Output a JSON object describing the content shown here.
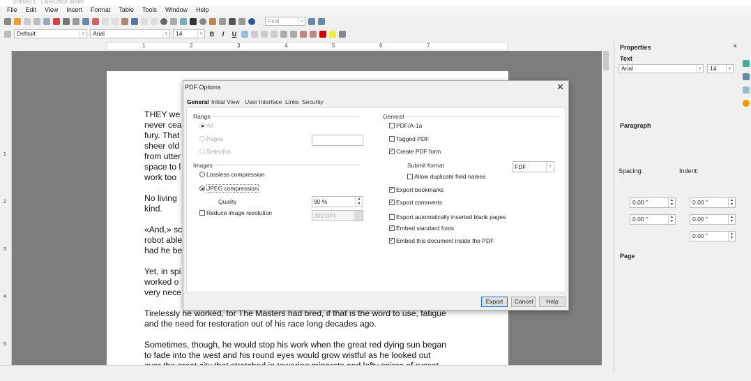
{
  "window": {
    "title": "Untitled 1 - LibreOffice Writer"
  },
  "menu": [
    "File",
    "Edit",
    "View",
    "Insert",
    "Format",
    "Table",
    "Tools",
    "Window",
    "Help"
  ],
  "toolbar": {
    "find_placeholder": "Find",
    "paragraph_style": "Default",
    "font_name": "Arial",
    "font_size": "14",
    "bold": "B",
    "italic": "I",
    "underline": "U"
  },
  "ruler": {
    "ticks": [
      "1",
      "2",
      "3",
      "4",
      "5",
      "6",
      "7"
    ]
  },
  "vruler": {
    "ticks": [
      "1",
      "2",
      "3",
      "4",
      "5"
    ]
  },
  "document": {
    "paragraphs": [
      "THEY we\nnever cea\nfury. That\nsheer old\nfrom utter\nspace to l\nwork too",
      "No living\nkind.",
      "«And,» sc\nrobot able\nhad he be",
      "Yet, in spi\nworked o\nvery nece",
      "Tirelessly he worked, for The Masters had bred, if that is the word to use, fatigue\nand the need for restoration out of his race long decades ago.",
      "Sometimes, though, he would stop his work when the great red dying sun began\nto fade into the west and his round eyes would grow wistful as he looked out\nover the great city that stretched in towering minarets and lofty spires of russet"
    ]
  },
  "sidebar": {
    "title": "Properties",
    "text_section": "Text",
    "font_name": "Arial",
    "font_size": "14",
    "paragraph_section": "Paragraph",
    "spacing_label": "Spacing:",
    "indent_label": "Indent:",
    "spacing_values": [
      "0.00 \"",
      "0.00 \""
    ],
    "indent_values": [
      "0.00 \"",
      "0.00 \"",
      "0.00 \""
    ],
    "page_section": "Page"
  },
  "dialog": {
    "title": "PDF Options",
    "tabs": [
      "General",
      "Initial View",
      "User Interface",
      "Links",
      "Security"
    ],
    "active_tab": "General",
    "range": {
      "label": "Range",
      "all": "All",
      "pages": "Pages",
      "selection": "Selection",
      "pages_value": ""
    },
    "images": {
      "label": "Images",
      "lossless": "Lossless compression",
      "jpeg": "JPEG compression",
      "selected": "JPEG compression",
      "quality_label": "Quality",
      "quality_value": "90 %",
      "reduce_label": "Reduce image resolution",
      "reduce_checked": false,
      "resolution_value": "300 DPI"
    },
    "general": {
      "label": "General",
      "options": [
        {
          "label": "PDF/A-1a",
          "checked": false
        },
        {
          "label": "Tagged PDF",
          "checked": false
        },
        {
          "label": "Create PDF form",
          "checked": true
        },
        {
          "label": "Allow duplicate field names",
          "checked": false
        },
        {
          "label": "Export bookmarks",
          "checked": true
        },
        {
          "label": "Export comments",
          "checked": true
        },
        {
          "label": "Export automatically inserted blank pages",
          "checked": false
        },
        {
          "label": "Embed standard fonts",
          "checked": true
        },
        {
          "label": "Embed this document inside the PDF",
          "checked": true
        }
      ],
      "submit_format_label": "Submit format",
      "submit_format_value": "FDF"
    },
    "buttons": {
      "export": "Export",
      "cancel": "Cancel",
      "help": "Help"
    }
  }
}
